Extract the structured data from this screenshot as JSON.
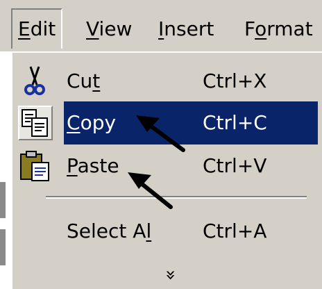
{
  "menubar": {
    "edit": {
      "label": "Edit",
      "mnemonic": "E",
      "rest": "dit"
    },
    "view": {
      "label": "View",
      "mnemonic": "V",
      "rest": "iew"
    },
    "insert": {
      "label": "Insert",
      "mnemonic": "I",
      "rest": "nsert"
    },
    "format": {
      "label": "Format",
      "pre": "F",
      "mnemonic": "o",
      "rest": "rmat"
    }
  },
  "edit_menu": {
    "items": [
      {
        "label": "Cut",
        "pre": "Cu",
        "mnemonic": "t",
        "rest": "",
        "shortcut": "Ctrl+X",
        "icon": "scissors-icon"
      },
      {
        "label": "Copy",
        "pre": "",
        "mnemonic": "C",
        "rest": "opy",
        "shortcut": "Ctrl+C",
        "icon": "copy-icon",
        "selected": true
      },
      {
        "label": "Paste",
        "pre": "",
        "mnemonic": "P",
        "rest": "aste",
        "shortcut": "Ctrl+V",
        "icon": "paste-icon"
      },
      {
        "label": "Select All",
        "pre": "Select A",
        "mnemonic": "l",
        "rest": "l",
        "shortcut": "Ctrl+A"
      }
    ],
    "more_glyph": "»"
  },
  "colors": {
    "menu_bg": "#d4d0c8",
    "highlight": "#0a246a",
    "highlight_text": "#ffffff"
  }
}
